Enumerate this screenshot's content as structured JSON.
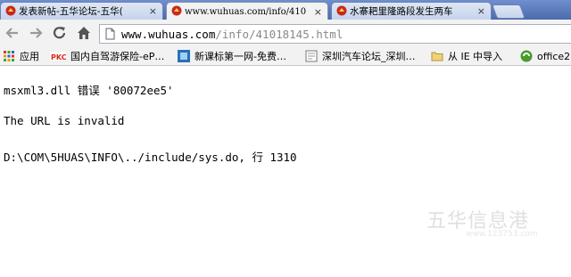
{
  "tabs": [
    {
      "title": "发表新帖-五华论坛-五华(",
      "state": "inactive"
    },
    {
      "title": "www.wuhuas.com/info/410",
      "state": "active"
    },
    {
      "title": "水寨耙里隆路段发生两车",
      "state": "inactive"
    }
  ],
  "close_glyph": "×",
  "address": {
    "host": "www.wuhuas.com",
    "path": "/info/41018145.html"
  },
  "bookmarks": [
    {
      "label": "应用",
      "icon": "apps-grid-icon"
    },
    {
      "label": "国内自驾游保险-eP…",
      "icon": "pkc-icon"
    },
    {
      "label": "新课标第一网-免费…",
      "icon": "site-icon"
    },
    {
      "label": "深圳汽车论坛_深圳…",
      "icon": "page-icon"
    },
    {
      "label": "从 IE 中导入",
      "icon": "folder-icon"
    },
    {
      "label": "office2",
      "icon": "office-icon"
    }
  ],
  "content": {
    "line1": "msxml3.dll 错误 '80072ee5'",
    "line2": "The URL is invalid",
    "line3": "D:\\COM\\5HUAS\\INFO\\../include/sys.do, 行 1310"
  },
  "watermark": {
    "main": "五华信息港",
    "sub": "www.123753.com"
  },
  "colors": {
    "tabstrip": "#4a6aab",
    "toolbar": "#f2f2f2",
    "pkc_red": "#d9261c"
  }
}
